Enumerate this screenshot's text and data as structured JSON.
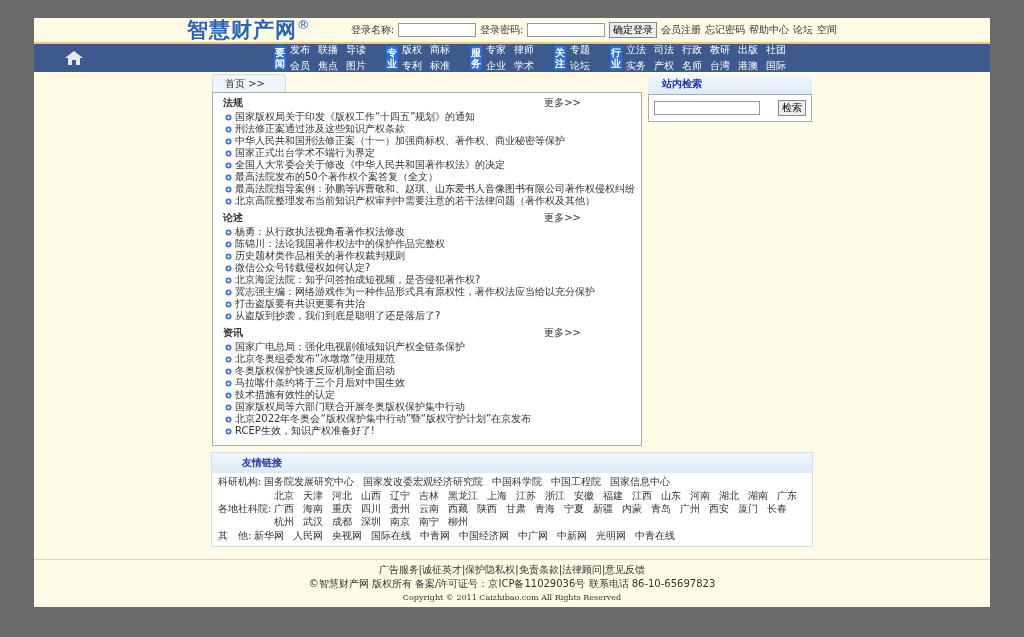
{
  "header": {
    "logo": "智慧财产网$^{®}$",
    "login_name_label": "登录名称:",
    "password_label": "登录密码:",
    "login_button": "确定登录",
    "links": [
      "会员注册",
      "忘记密码",
      "帮助中心",
      "论坛",
      "空间"
    ]
  },
  "nav": [
    {
      "label": "要闻",
      "rows": [
        [
          "发布",
          "联播",
          "导读"
        ],
        [
          "会员",
          "焦点",
          "图片"
        ]
      ]
    },
    {
      "label": "专业",
      "rows": [
        [
          "版权",
          "商标"
        ],
        [
          "专利",
          "标准"
        ]
      ]
    },
    {
      "label": "服务",
      "rows": [
        [
          "专家",
          "律师"
        ],
        [
          "企业",
          "学术"
        ]
      ]
    },
    {
      "label": "关注",
      "rows": [
        [
          "专题"
        ],
        [
          "论坛"
        ]
      ]
    },
    {
      "label": "行业",
      "rows": [
        [
          "立法",
          "司法",
          "行政",
          "教研",
          "出版",
          "社团"
        ],
        [
          "实务",
          "产权",
          "名师",
          "台湾",
          "港澳",
          "国际"
        ]
      ]
    }
  ],
  "breadcrumb": "首页 >>",
  "sections": [
    {
      "title": "法规",
      "more": "更多>>",
      "items": [
        "国家版权局关于印发《版权工作“十四五”规划》的通知",
        "刑法修正案通过涉及这些知识产权条款",
        "中华人民共和国刑法修正案（十一）加强商标权、著作权、商业秘密等保护",
        "国家正式出台学术不端行为界定",
        "全国人大常委会关于修改《中华人民共和国著作权法》的决定",
        "最高法院发布的50个著作权个案答复（全文）",
        "最高法院指导案例：孙鹏等诉曹敬和、赵琪、山东爱书人音像图书有限公司著作权侵权纠纷",
        "北京高院整理发布当前知识产权审判中需要注意的若干法律问题（著作权及其他）"
      ]
    },
    {
      "title": "论述",
      "more": "更多>>",
      "items": [
        "杨勇：从行政执法视角看著作权法修改",
        "陈锦川：法论我国著作权法中的保护作品完整权",
        "历史题材类作品相关的著作权裁判规则",
        "微信公众号转载侵权如何认定?",
        "北京海淀法院：知乎问答拍成短视频，是否侵犯著作权?",
        "冀志强主编：网络游戏作为一种作品形式具有原权性，著作权法应当给以充分保护",
        "打击盗版要有共识更要有共治",
        "从盗版到抄袭，我们到底是聪明了还是落后了?"
      ]
    },
    {
      "title": "资讯",
      "more": "更多>>",
      "items": [
        "国家广电总局：强化电视剧领域知识产权全链条保护",
        "北京冬奥组委发布“冰墩墩”使用规范",
        "冬奥版权保护快速反应机制全面启动",
        "马拉喀什条约将于三个月后对中国生效",
        "技术措施有效性的认定",
        "国家版权局等六部门联合开展冬奥版权保护集中行动",
        "北京2022年冬奥会“版权保护集中行动”暨“版权守护计划”在京发布",
        "RCEP生效，知识产权准备好了!"
      ]
    }
  ],
  "search": {
    "title": "站内检索",
    "button": "检索"
  },
  "friend_links": {
    "title": "友情链接",
    "groups": [
      {
        "label": "科研机构:",
        "items": [
          "国务院发展研究中心",
          "国家发改委宏观经济研究院",
          "中国科学院",
          "中国工程院",
          "国家信息中心"
        ]
      },
      {
        "label": "各地社科院:",
        "items": [
          "北京",
          "天津",
          "河北",
          "山西",
          "辽宁",
          "吉林",
          "黑龙江",
          "上海",
          "江苏",
          "浙江",
          "安徽",
          "福建",
          "江西",
          "山东",
          "河南",
          "湖北",
          "湖南",
          "广东",
          "广西",
          "海南",
          "重庆",
          "四川",
          "贵州",
          "云南",
          "西藏",
          "陕西",
          "甘肃",
          "青海",
          "宁夏",
          "新疆",
          "内蒙",
          "青岛",
          "广州",
          "西安",
          "厦门",
          "长春",
          "杭州",
          "武汉",
          "成都",
          "深圳",
          "南京",
          "南宁",
          "柳州"
        ]
      },
      {
        "label": "其　他:",
        "items": [
          "新华网",
          "人民网",
          "央视网",
          "国际在线",
          "中青网",
          "中国经济网",
          "中广网",
          "中新网",
          "光明网",
          "中青在线"
        ]
      }
    ]
  },
  "footer": {
    "links": "广告服务|诚征英才|保护隐私权|免责条款|法律顾问|意见反馈",
    "info": "©智慧财产网 版权所有 备案/许可证号：京ICP备11029036号 联系电话 86-10-65697823",
    "copyright": "Copyright © 2011 Caizhibao.com All Rights Reserved"
  }
}
